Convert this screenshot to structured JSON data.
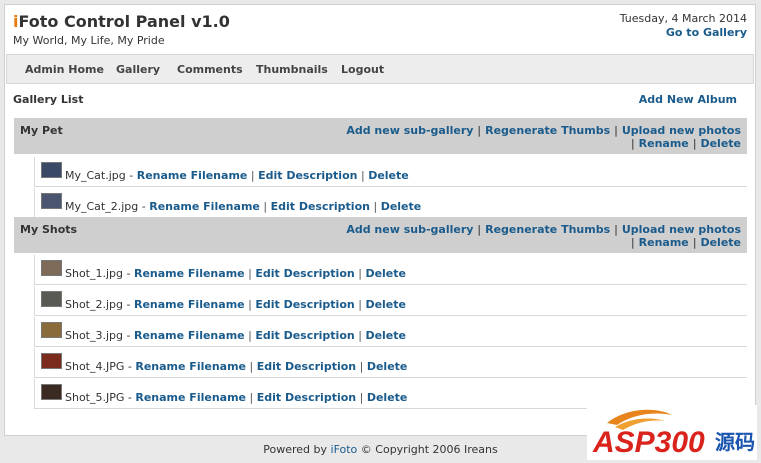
{
  "header": {
    "title_first": "i",
    "title_rest": "Foto Control Panel v1.0",
    "tagline": "My World, My Life, My Pride",
    "date": "Tuesday, 4 March 2014",
    "goto_gallery": "Go to Gallery"
  },
  "nav": {
    "items": [
      "Admin Home",
      "Gallery",
      "Comments",
      "Thumbnails",
      "Logout"
    ]
  },
  "gallery": {
    "title": "Gallery List",
    "add_album": "Add New Album",
    "actions": [
      "Add new sub-gallery",
      "Regenerate Thumbs",
      "Upload new photos",
      "Rename",
      "Delete"
    ],
    "photo_actions": [
      "Rename Filename",
      "Edit Description",
      "Delete"
    ],
    "albums": [
      {
        "name": "My Pet",
        "photos": [
          {
            "file": "My_Cat.jpg",
            "thumb_color": "#3a4a66"
          },
          {
            "file": "My_Cat_2.jpg",
            "thumb_color": "#4b5570"
          }
        ]
      },
      {
        "name": "My Shots",
        "photos": [
          {
            "file": "Shot_1.jpg",
            "thumb_color": "#7d6a58"
          },
          {
            "file": "Shot_2.jpg",
            "thumb_color": "#5a5a55"
          },
          {
            "file": "Shot_3.jpg",
            "thumb_color": "#8a6b3c"
          },
          {
            "file": "Shot_4.JPG",
            "thumb_color": "#7a2b1e"
          },
          {
            "file": "Shot_5.JPG",
            "thumb_color": "#3b2a22"
          }
        ]
      }
    ]
  },
  "footer": {
    "prefix": "Powered by",
    "brand": "iFoto",
    "suffix": "© Copyright 2006 Ireans"
  },
  "watermark": {
    "text": "ASP300",
    "cn": "源码",
    "colors": {
      "red": "#d9231c",
      "blue": "#1a55b0"
    }
  },
  "colors": {
    "link": "#1a5b8c",
    "accent": "#e87a0c",
    "album_header_bg": "#cfcfcf"
  }
}
